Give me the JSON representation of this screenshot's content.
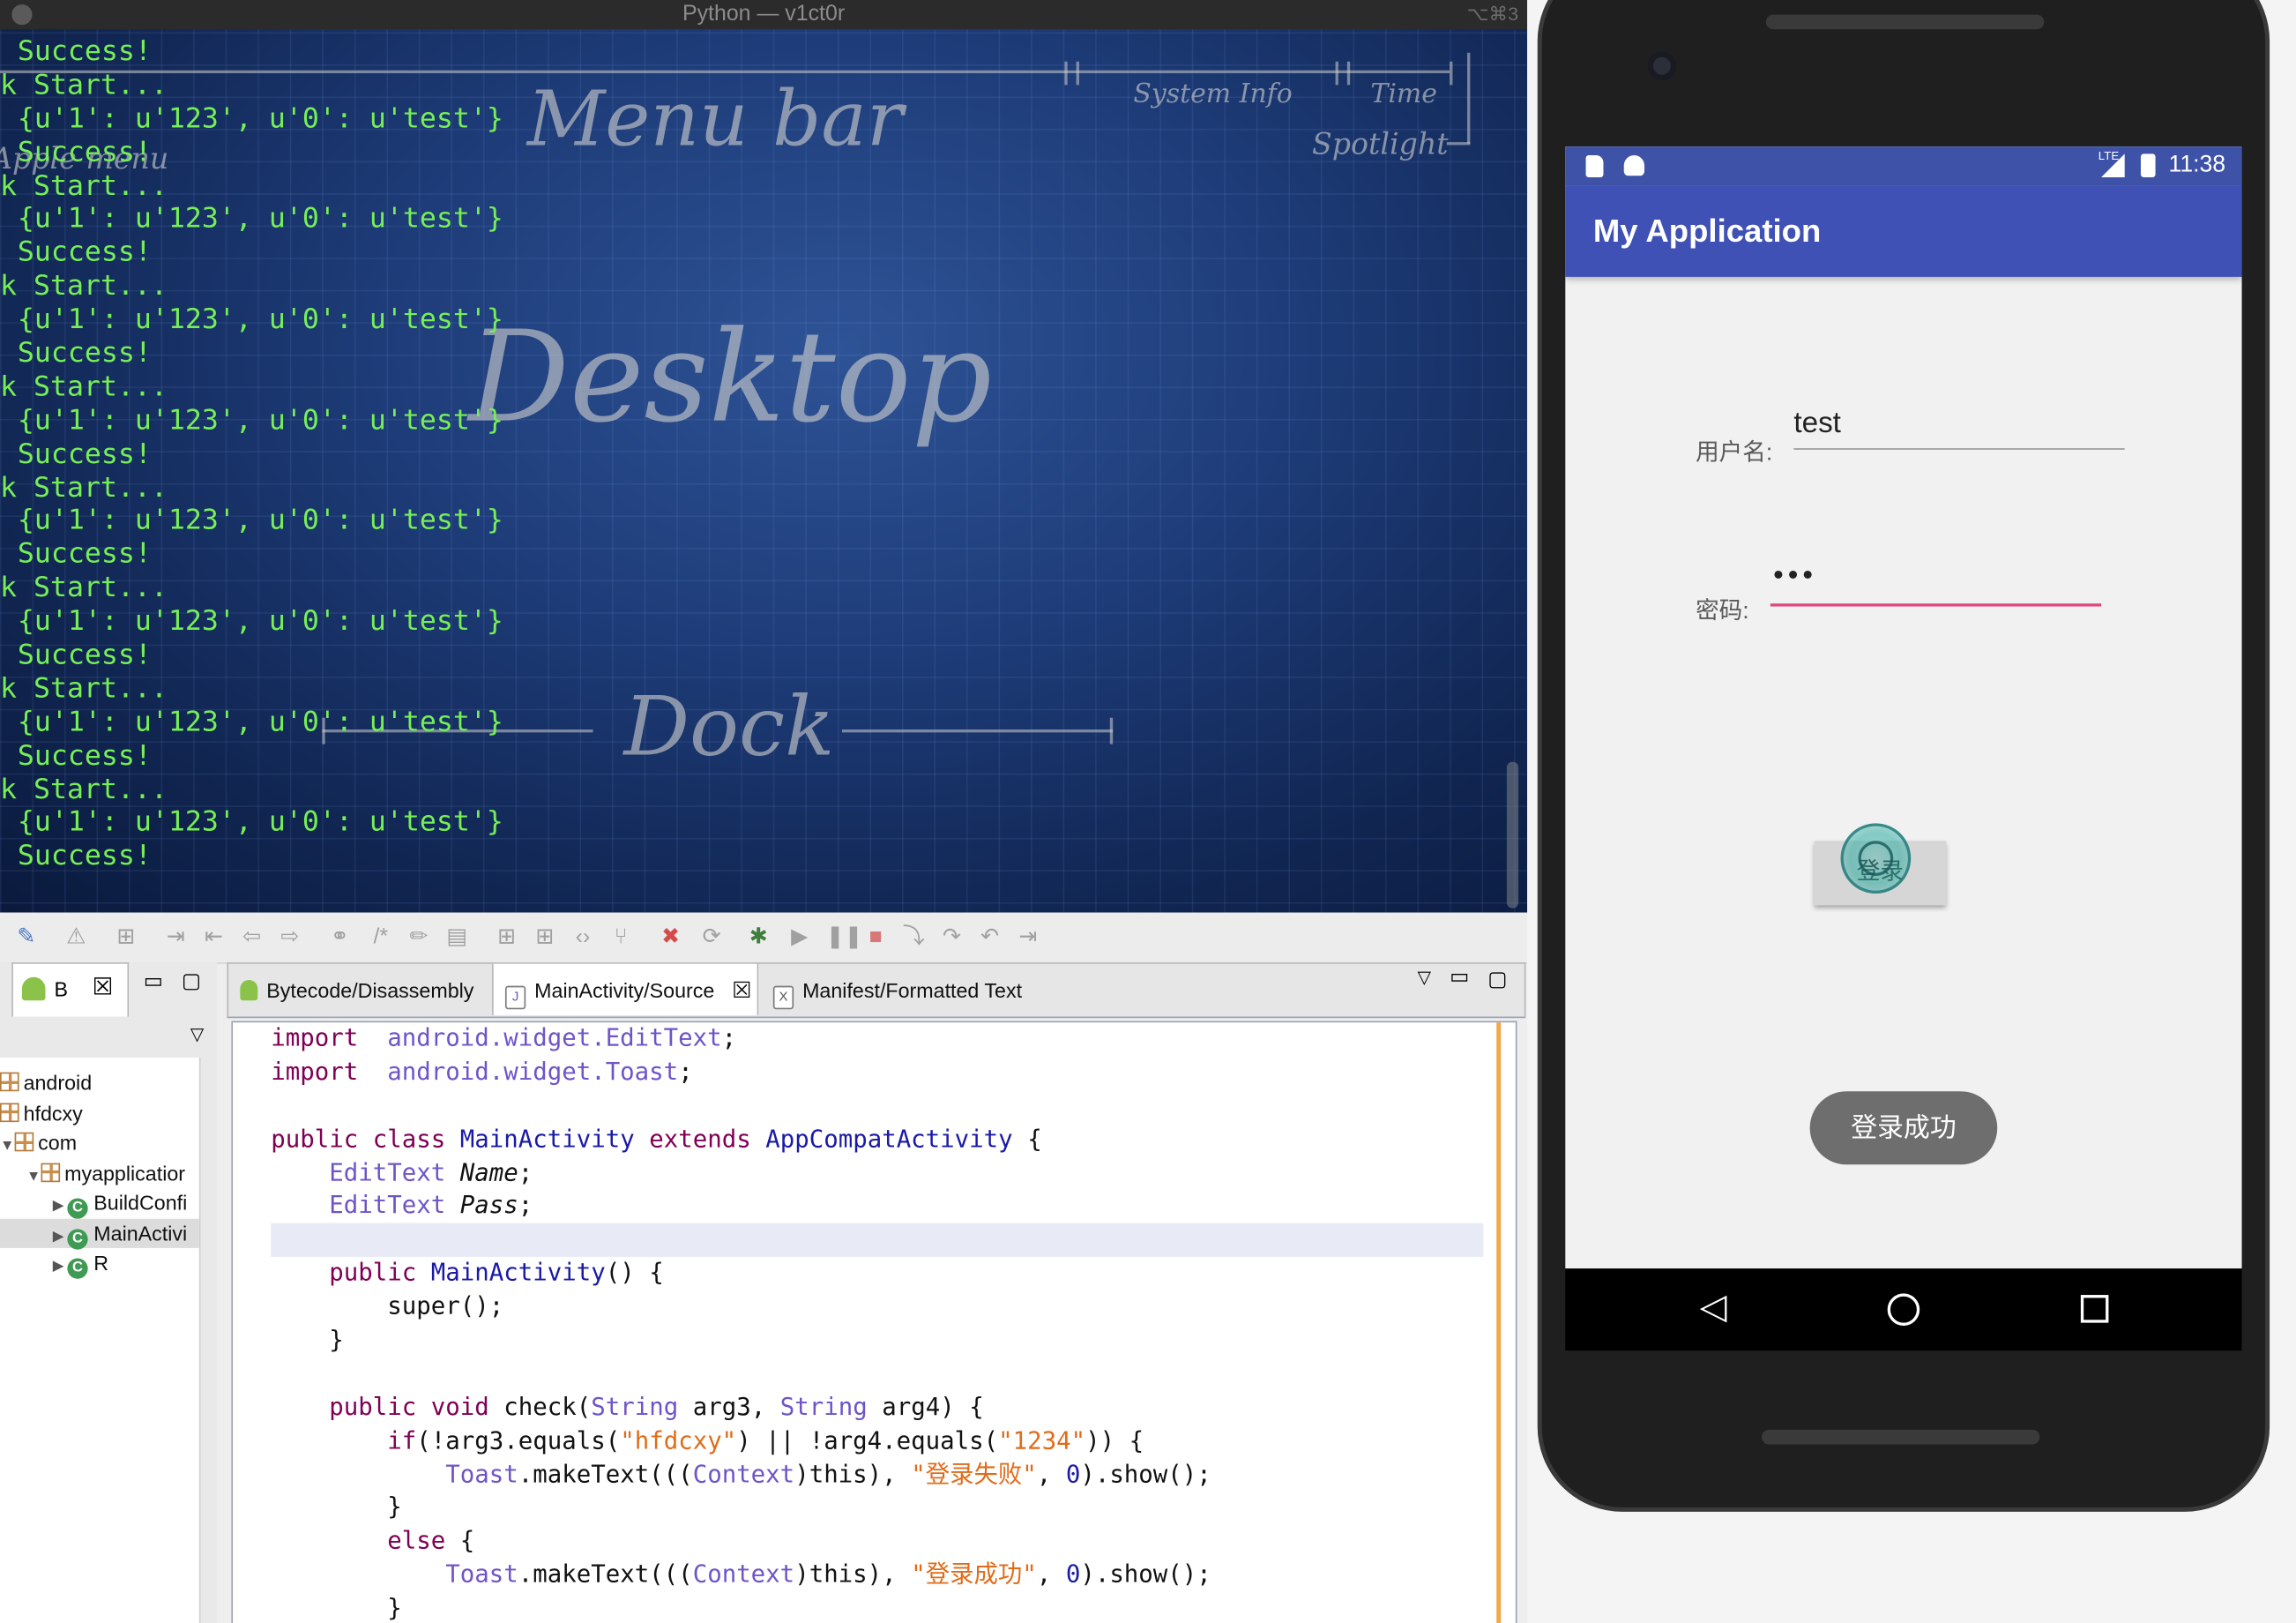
{
  "terminal": {
    "title": "Python — v1ct0r",
    "shortcut": "⌥⌘3",
    "lines": [
      "Success!",
      "k Start...",
      "{u'1': u'123', u'0': u'test'}",
      "Success!",
      "k Start...",
      "{u'1': u'123', u'0': u'test'}",
      "Success!",
      "k Start...",
      "{u'1': u'123', u'0': u'test'}",
      "Success!",
      "k Start...",
      "{u'1': u'123', u'0': u'test'}",
      "Success!",
      "k Start...",
      "{u'1': u'123', u'0': u'test'}",
      "Success!",
      "k Start...",
      "{u'1': u'123', u'0': u'test'}",
      "Success!",
      "k Start...",
      "{u'1': u'123', u'0': u'test'}",
      "Success!",
      "k Start...",
      "{u'1': u'123', u'0': u'test'}",
      "Success!"
    ],
    "wallpaper": {
      "menu_bar": "Menu bar",
      "system_info": "System Info",
      "time": "Time",
      "spotlight": "Spotlight",
      "desktop": "Desktop",
      "dock": "Dock",
      "apple_menu": "Apple menu"
    }
  },
  "ide": {
    "left_tab": "B",
    "tree": [
      {
        "label": "android",
        "kind": "package"
      },
      {
        "label": "hfdcxy",
        "kind": "package"
      },
      {
        "label": "com",
        "kind": "package"
      },
      {
        "label": "myapplicatior",
        "kind": "package"
      },
      {
        "label": "BuildConfi",
        "kind": "class"
      },
      {
        "label": "MainActivi",
        "kind": "class"
      },
      {
        "label": "R",
        "kind": "class"
      }
    ],
    "tabs": [
      {
        "label": "Bytecode/Disassembly"
      },
      {
        "label": "MainActivity/Source"
      },
      {
        "label": "Manifest/Formatted Text"
      }
    ],
    "code": [
      [
        [
          "kw",
          "import"
        ],
        [
          "",
          "  "
        ],
        [
          "ty",
          "android.widget.EditText"
        ],
        [
          "",
          ";"
        ]
      ],
      [
        [
          "kw",
          "import"
        ],
        [
          "",
          "  "
        ],
        [
          "ty",
          "android.widget.Toast"
        ],
        [
          "",
          ";"
        ]
      ],
      [],
      [
        [
          "kw",
          "public class"
        ],
        [
          "",
          " "
        ],
        [
          "cn",
          "MainActivity"
        ],
        [
          "",
          " "
        ],
        [
          "kw",
          "extends"
        ],
        [
          "",
          " "
        ],
        [
          "cn",
          "AppCompatActivity"
        ],
        [
          "",
          " {"
        ]
      ],
      [
        [
          "",
          "    "
        ],
        [
          "ty",
          "EditText"
        ],
        [
          "",
          " "
        ],
        [
          "it",
          "Name"
        ],
        [
          "",
          ";"
        ]
      ],
      [
        [
          "",
          "    "
        ],
        [
          "ty",
          "EditText"
        ],
        [
          "",
          " "
        ],
        [
          "it",
          "Pass"
        ],
        [
          "",
          ";"
        ]
      ],
      [],
      [
        [
          "",
          "    "
        ],
        [
          "kw",
          "public"
        ],
        [
          "",
          " "
        ],
        [
          "cn",
          "MainActivity"
        ],
        [
          "",
          "() {"
        ]
      ],
      [
        [
          "",
          "        super();"
        ]
      ],
      [
        [
          "",
          "    }"
        ]
      ],
      [],
      [
        [
          "",
          "    "
        ],
        [
          "kw",
          "public void"
        ],
        [
          "",
          " check("
        ],
        [
          "ty",
          "String"
        ],
        [
          "",
          " arg3, "
        ],
        [
          "ty",
          "String"
        ],
        [
          "",
          " arg4) {"
        ]
      ],
      [
        [
          "",
          "        "
        ],
        [
          "kw",
          "if"
        ],
        [
          "",
          "(!arg3.equals("
        ],
        [
          "str",
          "\"hfdcxy\""
        ],
        [
          "",
          ") || !arg4.equals("
        ],
        [
          "str",
          "\"1234\""
        ],
        [
          "",
          ")) {"
        ]
      ],
      [
        [
          "",
          "            "
        ],
        [
          "ty",
          "Toast"
        ],
        [
          "",
          ".makeText((("
        ],
        [
          "ty",
          "Context"
        ],
        [
          "",
          ")this), "
        ],
        [
          "str",
          "\"登录失败\""
        ],
        [
          "",
          ", "
        ],
        [
          "num",
          "0"
        ],
        [
          "",
          ").show();"
        ]
      ],
      [
        [
          "",
          "        }"
        ]
      ],
      [
        [
          "",
          "        "
        ],
        [
          "kw",
          "else"
        ],
        [
          "",
          " {"
        ]
      ],
      [
        [
          "",
          "            "
        ],
        [
          "ty",
          "Toast"
        ],
        [
          "",
          ".makeText((("
        ],
        [
          "ty",
          "Context"
        ],
        [
          "",
          ")this), "
        ],
        [
          "str",
          "\"登录成功\""
        ],
        [
          "",
          ", "
        ],
        [
          "num",
          "0"
        ],
        [
          "",
          ").show();"
        ]
      ],
      [
        [
          "",
          "        }"
        ]
      ]
    ]
  },
  "phone": {
    "time": "11:38",
    "network": "LTE",
    "app_title": "My Application",
    "username_label": "用户名:",
    "username_value": "test",
    "password_label": "密码:",
    "password_value": "•••",
    "login_button": "登录",
    "toast": "登录成功"
  }
}
